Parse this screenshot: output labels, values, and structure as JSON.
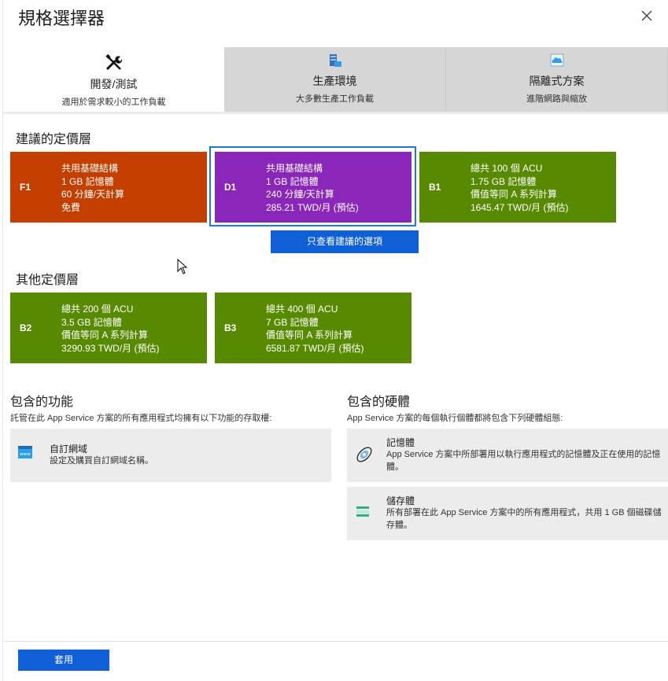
{
  "dialog": {
    "title": "規格選擇器",
    "close_label": "×"
  },
  "tabs": [
    {
      "label": "開發/測試",
      "sub": "適用於需求較小的工作負載",
      "icon": "tools-icon"
    },
    {
      "label": "生產環境",
      "sub": "大多數生產工作負載",
      "icon": "server-icon"
    },
    {
      "label": "隔離式方案",
      "sub": "進階網路與縮放",
      "icon": "cloud-icon"
    }
  ],
  "recommended": {
    "title": "建議的定價層",
    "tiers": [
      {
        "code": "F1",
        "lines": [
          "共用基礎結構",
          "1 GB 記憶體",
          "60 分鐘/天計算",
          "免費"
        ],
        "color": "#c43e00"
      },
      {
        "code": "D1",
        "lines": [
          "共用基礎結構",
          "1 GB 記憶體",
          "240 分鐘/天計算",
          "285.21 TWD/月 (預估)"
        ],
        "color": "#8a26b9"
      },
      {
        "code": "B1",
        "lines": [
          "總共 100 個 ACU",
          "1.75 GB 記憶體",
          "價值等同 A 系列計算",
          "1645.47 TWD/月 (預估)"
        ],
        "color": "#578a00"
      }
    ],
    "show_recommended_button": "只查看建議的選項"
  },
  "other": {
    "title": "其他定價層",
    "tiers": [
      {
        "code": "B2",
        "lines": [
          "總共 200 個 ACU",
          "3.5 GB 記憶體",
          "價值等同 A 系列計算",
          "3290.93 TWD/月 (預估)"
        ],
        "color": "#578a00"
      },
      {
        "code": "B3",
        "lines": [
          "總共 400 個 ACU",
          "7 GB 記憶體",
          "價值等同 A 系列計算",
          "6581.87 TWD/月 (預估)"
        ],
        "color": "#578a00"
      }
    ]
  },
  "features": {
    "title": "包含的功能",
    "desc": "託管在此 App Service 方案的所有應用程式均擁有以下功能的存取權:",
    "items": [
      {
        "title": "自訂網域",
        "desc": "設定及購買自訂網域名稱。",
        "icon": "www-icon"
      }
    ]
  },
  "hardware": {
    "title": "包含的硬體",
    "desc": "App Service 方案的每個執行個體都將包含下列硬體組態:",
    "items": [
      {
        "title": "記憶體",
        "desc": "App Service 方案中所部署用以執行應用程式的記憶體及正在使用的記憶體。",
        "icon": "memory-icon"
      },
      {
        "title": "儲存體",
        "desc": "所有部署在此 App Service 方案中的所有應用程式，共用 1 GB 個磁碟儲存體。",
        "icon": "storage-icon"
      }
    ]
  },
  "footer": {
    "apply_label": "套用"
  },
  "colors": {
    "accent": "#0f5fd7",
    "selected_border": "#1f7acb"
  }
}
